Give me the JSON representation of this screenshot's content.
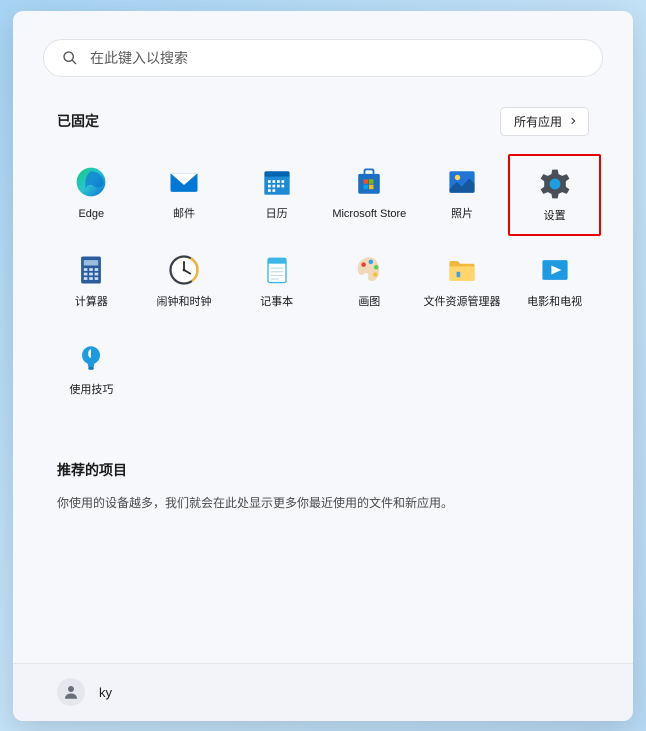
{
  "search": {
    "placeholder": "在此键入以搜索"
  },
  "pinned": {
    "title": "已固定",
    "all_apps_label": "所有应用",
    "apps": [
      {
        "id": "edge",
        "label": "Edge"
      },
      {
        "id": "mail",
        "label": "邮件"
      },
      {
        "id": "calendar",
        "label": "日历"
      },
      {
        "id": "store",
        "label": "Microsoft Store"
      },
      {
        "id": "photos",
        "label": "照片"
      },
      {
        "id": "settings",
        "label": "设置",
        "highlighted": true
      },
      {
        "id": "calculator",
        "label": "计算器"
      },
      {
        "id": "clock",
        "label": "闹钟和时钟"
      },
      {
        "id": "notepad",
        "label": "记事本"
      },
      {
        "id": "paint",
        "label": "画图"
      },
      {
        "id": "explorer",
        "label": "文件资源管理器"
      },
      {
        "id": "movies",
        "label": "电影和电视"
      },
      {
        "id": "tips",
        "label": "使用技巧"
      }
    ]
  },
  "recommended": {
    "title": "推荐的项目",
    "description": "你使用的设备越多，我们就会在此处显示更多你最近使用的文件和新应用。"
  },
  "user": {
    "name": "ky"
  }
}
